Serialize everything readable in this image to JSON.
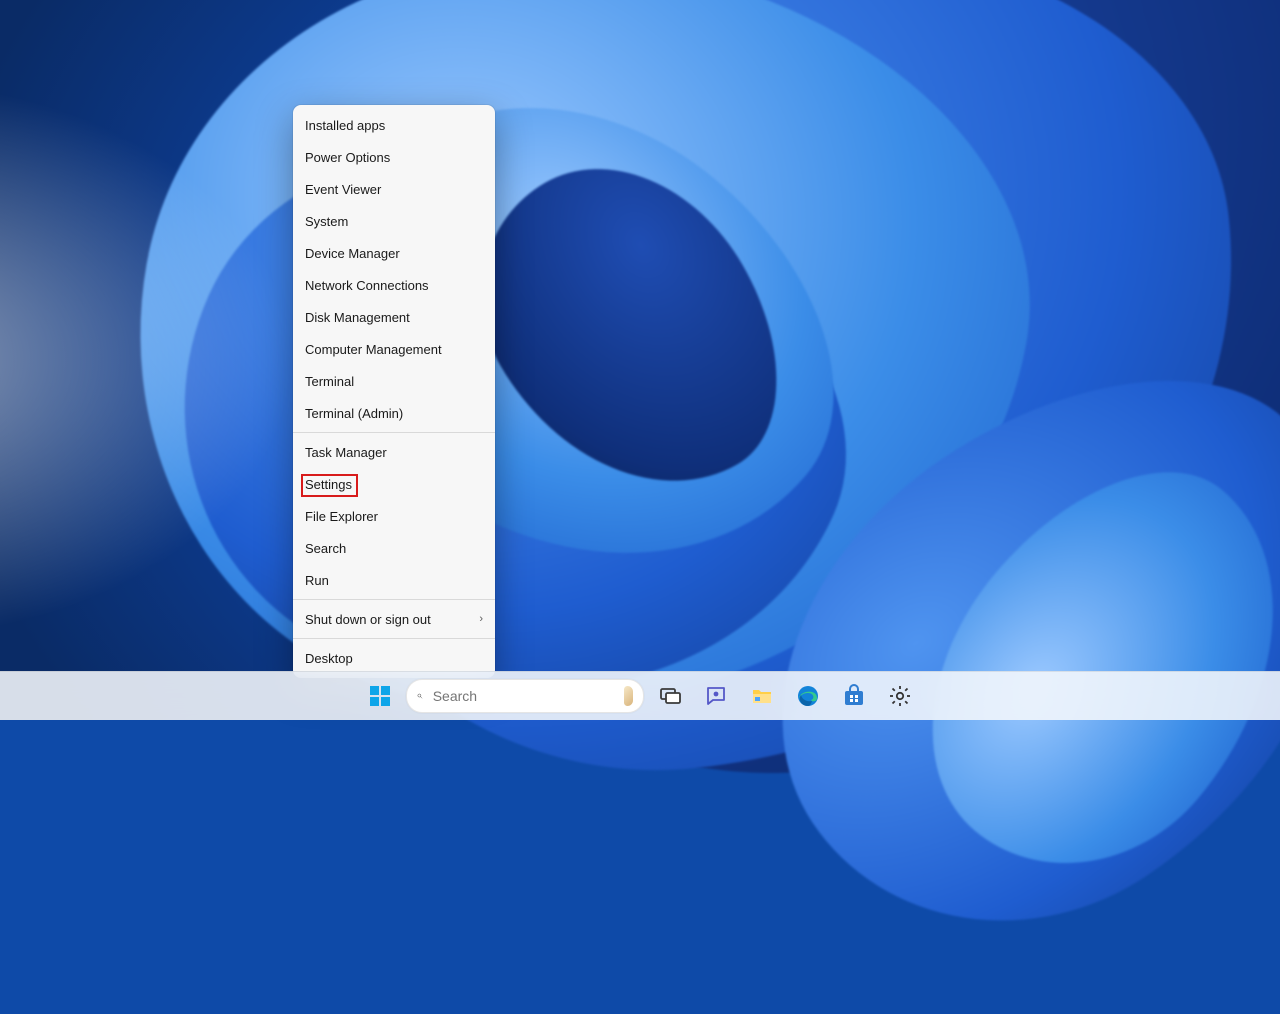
{
  "context_menu": {
    "groups": [
      [
        "Installed apps",
        "Power Options",
        "Event Viewer",
        "System",
        "Device Manager",
        "Network Connections",
        "Disk Management",
        "Computer Management",
        "Terminal",
        "Terminal (Admin)"
      ],
      [
        "Task Manager",
        "Settings",
        "File Explorer",
        "Search",
        "Run"
      ],
      [
        "Shut down or sign out"
      ],
      [
        "Desktop"
      ]
    ],
    "submenu_items": [
      "Shut down or sign out"
    ],
    "highlighted_item": "Settings"
  },
  "taskbar": {
    "search_placeholder": "Search",
    "icons": [
      {
        "name": "start-icon",
        "label": "Start"
      },
      {
        "name": "task-view-icon",
        "label": "Task view"
      },
      {
        "name": "chat-icon",
        "label": "Chat"
      },
      {
        "name": "file-explorer-icon",
        "label": "File Explorer"
      },
      {
        "name": "edge-icon",
        "label": "Microsoft Edge"
      },
      {
        "name": "store-icon",
        "label": "Microsoft Store"
      },
      {
        "name": "settings-icon",
        "label": "Settings"
      }
    ]
  }
}
